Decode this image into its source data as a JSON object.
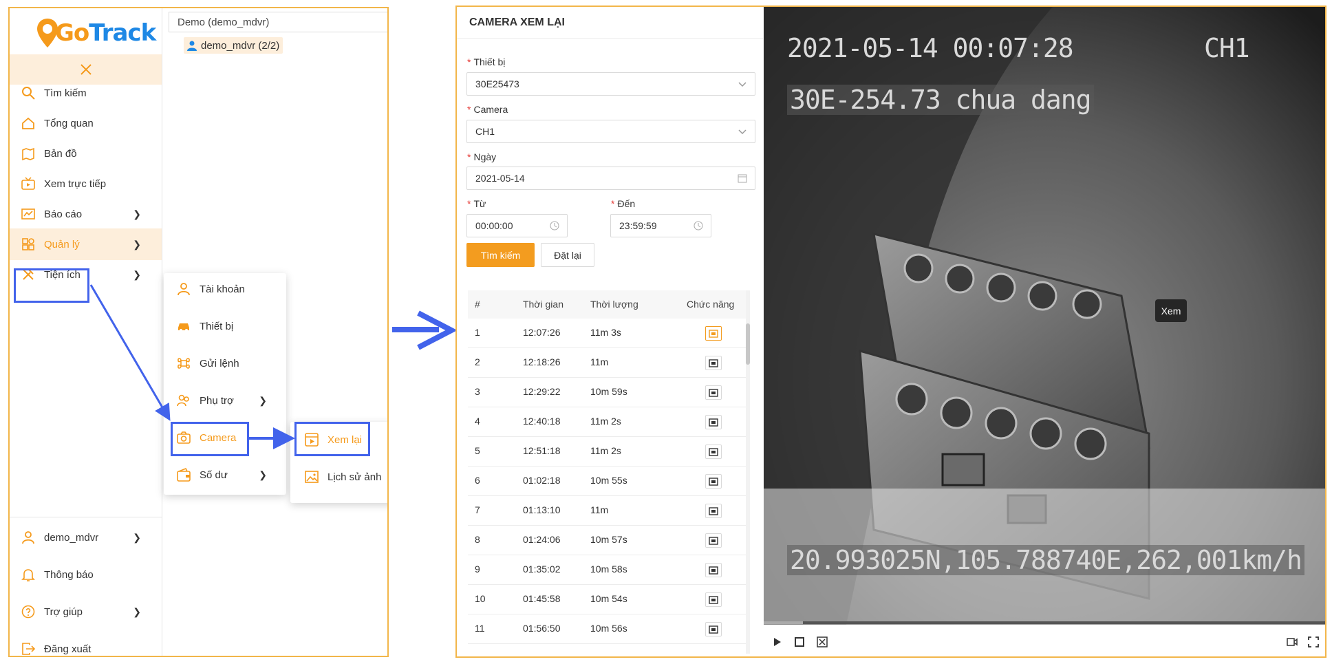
{
  "sidebar": {
    "logo": {
      "left": "Go",
      "right": "Track"
    },
    "menu": [
      {
        "label": "Tìm kiếm",
        "icon": "search-icon"
      },
      {
        "label": "Tổng quan",
        "icon": "home-icon"
      },
      {
        "label": "Bản đồ",
        "icon": "map-icon"
      },
      {
        "label": "Xem trực tiếp",
        "icon": "live-tv-icon"
      },
      {
        "label": "Báo cáo",
        "icon": "chart-icon"
      },
      {
        "label": "Quản lý",
        "icon": "grid-icon"
      },
      {
        "label": "Tiện ích",
        "icon": "tools-icon"
      }
    ],
    "bottom_menu": [
      {
        "label": "demo_mdvr",
        "icon": "user-icon"
      },
      {
        "label": "Thông báo",
        "icon": "bell-icon"
      },
      {
        "label": "Trợ giúp",
        "icon": "help-icon"
      },
      {
        "label": "Đăng xuất",
        "icon": "logout-icon"
      }
    ]
  },
  "tree": {
    "header": "Demo (demo_mdvr)",
    "node": "demo_mdvr (2/2)"
  },
  "submenu_manage": [
    {
      "label": "Tài khoản",
      "icon": "user-icon"
    },
    {
      "label": "Thiết bị",
      "icon": "car-icon"
    },
    {
      "label": "Gửi lệnh",
      "icon": "command-icon"
    },
    {
      "label": "Phụ trợ",
      "icon": "users-icon"
    },
    {
      "label": "Camera",
      "icon": "camera-icon"
    },
    {
      "label": "Số dư",
      "icon": "wallet-icon"
    }
  ],
  "submenu_camera": [
    {
      "label": "Xem lại",
      "icon": "playback-icon"
    },
    {
      "label": "Lịch sử ảnh",
      "icon": "image-icon"
    }
  ],
  "form": {
    "title": "CAMERA XEM LẠI",
    "device_label": "Thiết bị",
    "device_value": "30E25473",
    "camera_label": "Camera",
    "camera_value": "CH1",
    "date_label": "Ngày",
    "date_value": "2021-05-14",
    "from_label": "Từ",
    "from_value": "00:00:00",
    "to_label": "Đến",
    "to_value": "23:59:59",
    "search_button": "Tìm kiếm",
    "reset_button": "Đặt lại"
  },
  "table": {
    "columns": [
      "#",
      "Thời gian",
      "Thời lượng",
      "Chức năng"
    ],
    "tooltip": "Xem",
    "rows": [
      {
        "num": "1",
        "time": "12:07:26",
        "duration": "11m 3s"
      },
      {
        "num": "2",
        "time": "12:18:26",
        "duration": "11m"
      },
      {
        "num": "3",
        "time": "12:29:22",
        "duration": "10m 59s"
      },
      {
        "num": "4",
        "time": "12:40:18",
        "duration": "11m 2s"
      },
      {
        "num": "5",
        "time": "12:51:18",
        "duration": "11m 2s"
      },
      {
        "num": "6",
        "time": "01:02:18",
        "duration": "10m 55s"
      },
      {
        "num": "7",
        "time": "01:13:10",
        "duration": "11m"
      },
      {
        "num": "8",
        "time": "01:24:06",
        "duration": "10m 57s"
      },
      {
        "num": "9",
        "time": "01:35:02",
        "duration": "10m 58s"
      },
      {
        "num": "10",
        "time": "01:45:58",
        "duration": "10m 54s"
      },
      {
        "num": "11",
        "time": "01:56:50",
        "duration": "10m 56s"
      }
    ]
  },
  "video": {
    "timestamp": "2021-05-14 00:07:28",
    "channel": "CH1",
    "plate": "30E-254.73 chua dang",
    "gps": "20.993025N,105.788740E,262,001km/h",
    "progress": 0.07
  },
  "colors": {
    "accent": "#f39c1f",
    "annotation": "#4263eb",
    "panel_border": "#f2b64a"
  }
}
